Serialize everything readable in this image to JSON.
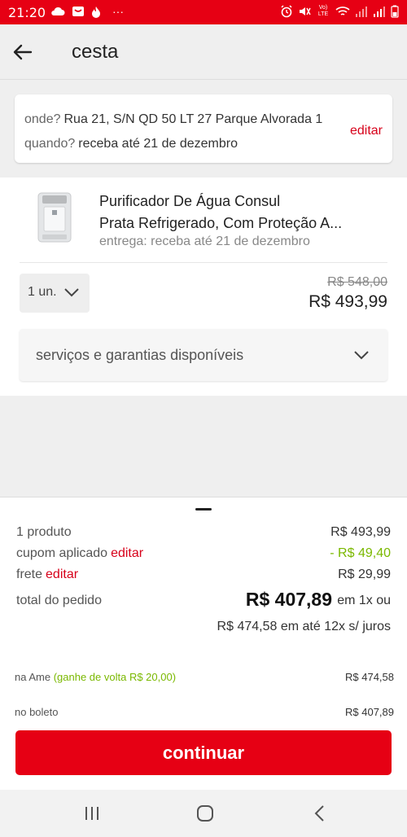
{
  "status_bar": {
    "time": "21:20",
    "more": "···",
    "lte": "Vo) LTE"
  },
  "header": {
    "title": "cesta"
  },
  "delivery": {
    "where_label": "onde?",
    "where_value": "Rua 21, S/N QD 50 LT 27 Parque Alvorada 1",
    "when_label": "quando?",
    "when_value": "receba até 21 de dezembro",
    "edit": "editar"
  },
  "product": {
    "name_line1": "Purificador De Água Consul",
    "name_line2": "Prata Refrigerado, Com Proteção A...",
    "delivery": "entrega: receba até 21 de dezembro",
    "quantity": "1 un.",
    "old_price": "R$ 548,00",
    "price": "R$ 493,99",
    "services": "serviços e garantias disponíveis"
  },
  "summary": {
    "products_label": "1 produto",
    "products_value": "R$ 493,99",
    "coupon_label": "cupom aplicado",
    "coupon_edit": "editar",
    "coupon_value": "- R$ 49,40",
    "shipping_label": "frete",
    "shipping_edit": "editar",
    "shipping_value": "R$ 29,99",
    "total_label": "total do pedido",
    "total_value": "R$ 407,89",
    "total_suffix": "em 1x ou",
    "installments": "R$ 474,58 em até 12x s/ juros",
    "ame_label": "na Ame",
    "ame_cashback": "(ganhe de volta R$ 20,00)",
    "ame_value": "R$ 474,58",
    "boleto_label": "no boleto",
    "boleto_value": "R$ 407,89",
    "continue": "continuar"
  },
  "colors": {
    "brand_red": "#e60014",
    "link_red": "#d7001a",
    "cashback_green": "#7ab800"
  }
}
